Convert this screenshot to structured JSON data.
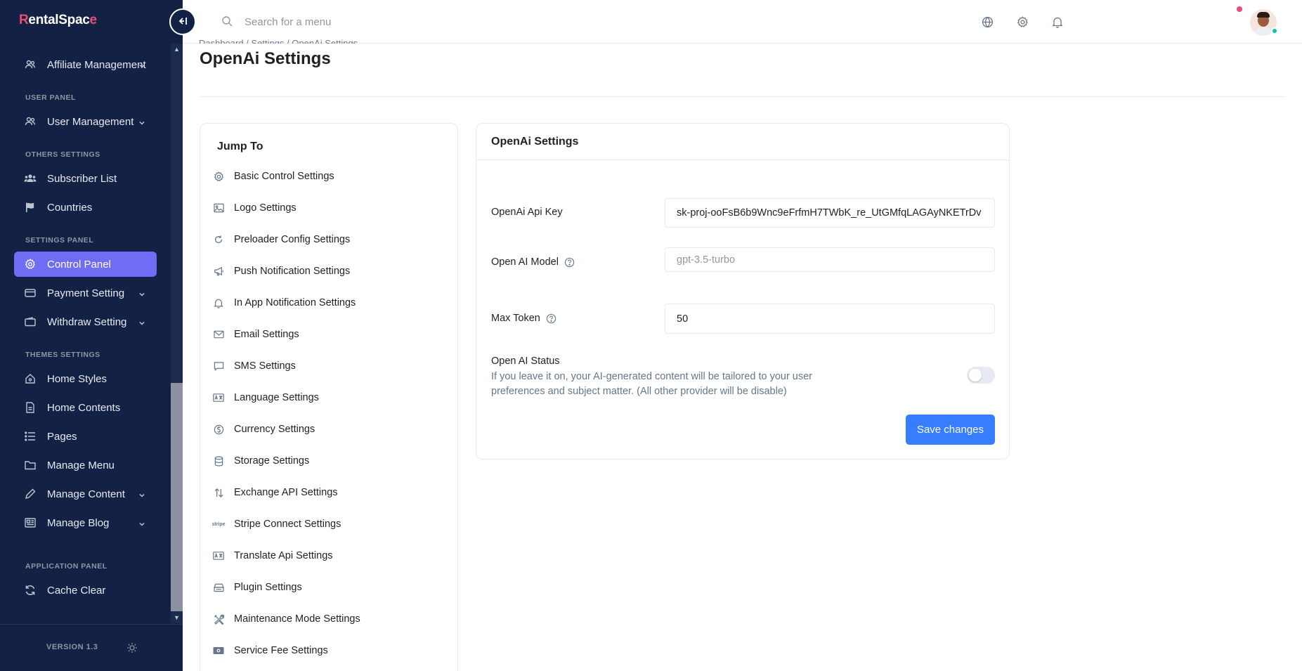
{
  "brand": {
    "logo_first": "R",
    "logo_mid": "entalSpac",
    "logo_last": "e"
  },
  "sidebar": {
    "collapse_icon": "collapse-left-icon",
    "sections": {
      "user_panel": "USER PANEL",
      "others_settings": "OTHERS SETTINGS",
      "settings_panel": "SETTINGS PANEL",
      "themes_settings": "THEMES SETTINGS",
      "application_panel": "APPLICATION PANEL"
    },
    "items": {
      "affiliate": "Affiliate Management",
      "user_management": "User Management",
      "subscriber": "Subscriber List",
      "countries": "Countries",
      "control_panel": "Control Panel",
      "payment": "Payment Setting",
      "withdraw": "Withdraw Setting",
      "home_styles": "Home Styles",
      "home_contents": "Home Contents",
      "pages": "Pages",
      "manage_menu": "Manage Menu",
      "manage_content": "Manage Content",
      "manage_blog": "Manage Blog",
      "cache_clear": "Cache Clear"
    },
    "active_item": "Control Panel",
    "version": "VERSION 1.3",
    "active_color": "#6f6cf6",
    "bg_color": "#132144"
  },
  "header": {
    "search_placeholder": "Search for a menu",
    "icons": [
      "globe-icon",
      "gear-icon",
      "bell-icon"
    ],
    "notification_dot_color": "#ed4c78"
  },
  "page": {
    "breadcrumb": "Dashboard / Settings / OpenAi Settings",
    "title": "OpenAi Settings"
  },
  "jump_to": {
    "title": "Jump To",
    "items": [
      {
        "label": "Basic Control Settings",
        "icon": "gear-icon"
      },
      {
        "label": "Logo Settings",
        "icon": "image-icon"
      },
      {
        "label": "Preloader Config Settings",
        "icon": "refresh-icon"
      },
      {
        "label": "Push Notification Settings",
        "icon": "megaphone-icon"
      },
      {
        "label": "In App Notification Settings",
        "icon": "bell-icon"
      },
      {
        "label": "Email Settings",
        "icon": "envelope-icon"
      },
      {
        "label": "SMS Settings",
        "icon": "chat-icon"
      },
      {
        "label": "Language Settings",
        "icon": "translate-icon"
      },
      {
        "label": "Currency Settings",
        "icon": "currency-icon"
      },
      {
        "label": "Storage Settings",
        "icon": "database-icon"
      },
      {
        "label": "Exchange API Settings",
        "icon": "arrows-exchange-icon"
      },
      {
        "label": "Stripe Connect Settings",
        "icon": "stripe-icon",
        "icon_text": "stripe"
      },
      {
        "label": "Translate Api Settings",
        "icon": "translate-icon"
      },
      {
        "label": "Plugin Settings",
        "icon": "plugin-icon"
      },
      {
        "label": "Maintenance Mode Settings",
        "icon": "tools-icon"
      },
      {
        "label": "Service Fee Settings",
        "icon": "cash-icon"
      }
    ]
  },
  "openai": {
    "card_title": "OpenAi Settings",
    "api_key_label": "OpenAi Api Key",
    "api_key_value": "sk-proj-ooFsB6b9Wnc9eFrfmH7TWbK_re_UtGMfqLAGAyNKETrDv",
    "model_label": "Open AI Model",
    "model_placeholder": "gpt-3.5-turbo",
    "max_token_label": "Max Token",
    "max_token_value": "50",
    "status_title": "Open AI Status",
    "status_desc": "If you leave it on, your AI-generated content will be tailored to your user preferences and subject matter. (All other provider will be disable)",
    "status_on": false,
    "save_label": "Save changes",
    "button_color": "#377dff"
  }
}
